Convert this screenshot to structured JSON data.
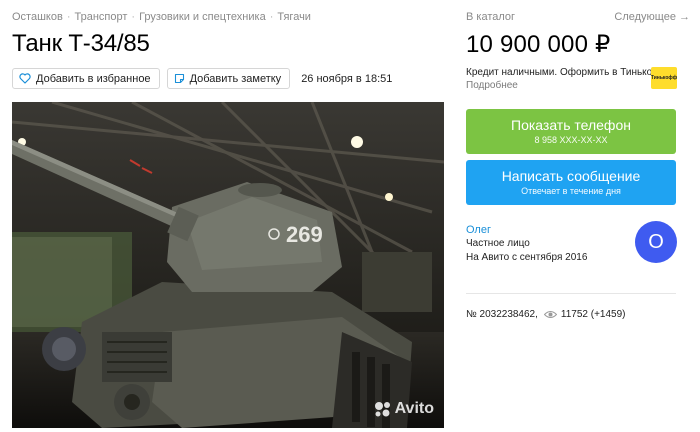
{
  "breadcrumbs": [
    "Осташков",
    "Транспорт",
    "Грузовики и спецтехника",
    "Тягачи"
  ],
  "breadcrumb_separator": "·",
  "title": "Танк Т-34/85",
  "actions": {
    "favorite_label": "Добавить в избранное",
    "note_label": "Добавить заметку",
    "date": "26 ноября в 18:51"
  },
  "photo": {
    "watermark": "Avito",
    "tank_number": "269"
  },
  "sidebar": {
    "catalog_link": "В каталог",
    "next_link": "Следующее →",
    "price": "10 900 000 ₽",
    "credit_text": "Кредит наличными. Оформить в Тинькофф.",
    "credit_more": "Подробнее",
    "partner_logo_text": "Тинькофф",
    "phone_button": {
      "label": "Показать телефон",
      "sub": "8 958 XXX-XX-XX"
    },
    "message_button": {
      "label": "Написать сообщение",
      "sub": "Отвечает в течение дня"
    },
    "seller": {
      "name": "Олег",
      "type": "Частное лицо",
      "since": "На Авито с сентября 2016",
      "avatar_letter": "О"
    },
    "ad_number": "№ 2032238462,",
    "views": "11752 (+1459)"
  },
  "colors": {
    "phone_button": "#7cc443",
    "message_button": "#1fa3f2",
    "avatar": "#3f5bf0",
    "link": "#1a8fd8",
    "tinkoff": "#fedd2c"
  }
}
